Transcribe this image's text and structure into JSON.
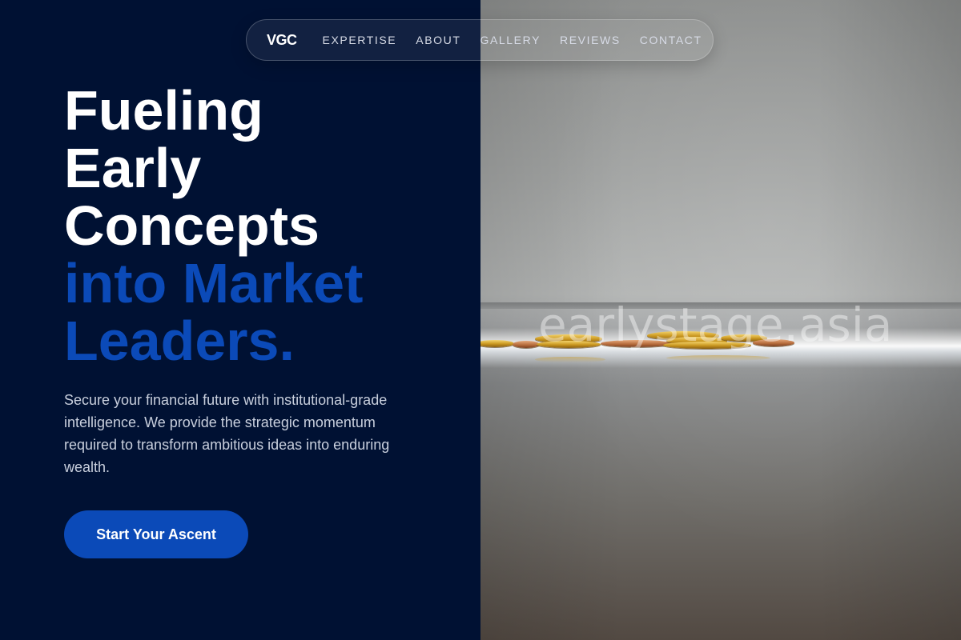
{
  "nav": {
    "logo": "VGC",
    "items": [
      {
        "label": "EXPERTISE"
      },
      {
        "label": "ABOUT"
      },
      {
        "label": "GALLERY"
      },
      {
        "label": "REVIEWS"
      },
      {
        "label": "CONTACT"
      }
    ]
  },
  "hero": {
    "headline_lines_white": [
      "Fueling",
      "Early",
      "Concepts"
    ],
    "headline_lines_accent": [
      "into Market",
      "Leaders."
    ],
    "description": "Secure your financial future with institutional-grade intelligence. We provide the strategic momentum required to transform ambitious ideas into enduring wealth.",
    "cta_label": "Start Your Ascent"
  },
  "image": {
    "watermark": "earlystage.asia",
    "subject": "coins-on-table-photo"
  },
  "colors": {
    "background": "#001133",
    "accent": "#0b4ab8",
    "heading": "#ffffff",
    "body_text": "#c8cfdd"
  }
}
